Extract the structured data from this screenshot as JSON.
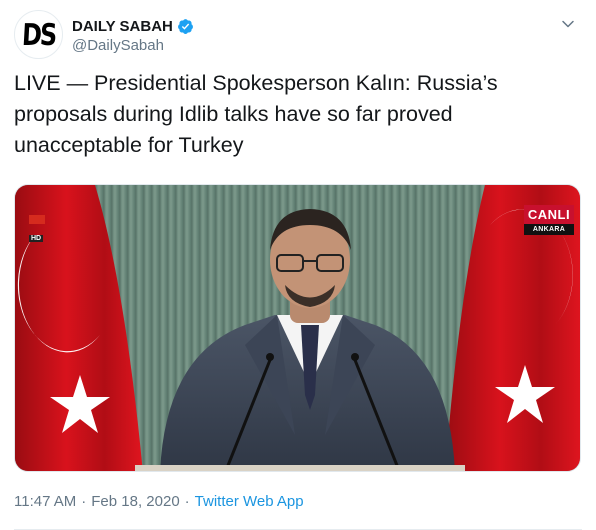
{
  "account": {
    "display_name": "DAILY SABAH",
    "handle": "@DailySabah",
    "avatar_text": "DS",
    "verified": true
  },
  "tweet": {
    "text": "LIVE — Presidential Spokesperson Kalın: Russia’s proposals during Idlib talks have so far proved unacceptable for Turkey"
  },
  "media": {
    "live_badge": "CANLI",
    "location_badge": "ANKARA",
    "channel_logo": "HD"
  },
  "meta": {
    "time": "11:47 AM",
    "separator": "·",
    "date": "Feb 18, 2020",
    "source": "Twitter Web App"
  },
  "icons": {
    "verified": "verified-badge-icon",
    "caret": "chevron-down-icon"
  },
  "colors": {
    "verified_blue": "#1da1f2",
    "link_blue": "#1b95e0",
    "secondary_text": "#657786",
    "flag_red": "#e30a17"
  }
}
